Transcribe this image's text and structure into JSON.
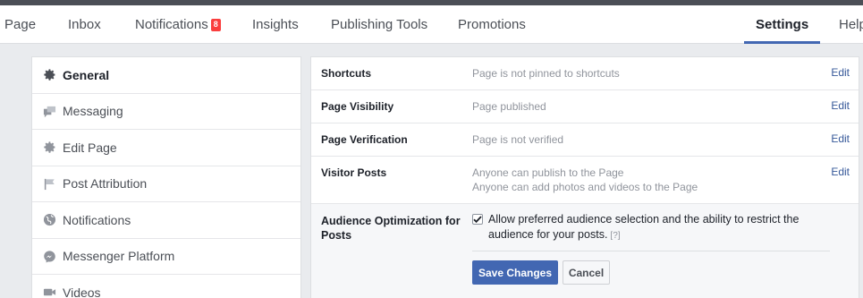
{
  "nav": {
    "items": [
      {
        "label": "Page"
      },
      {
        "label": "Inbox"
      },
      {
        "label": "Notifications",
        "badge": "8"
      },
      {
        "label": "Insights"
      },
      {
        "label": "Publishing Tools"
      },
      {
        "label": "Promotions"
      },
      {
        "label": "Settings",
        "active": true
      },
      {
        "label": "Help"
      }
    ]
  },
  "sidebar": {
    "items": [
      {
        "label": "General",
        "icon": "gear-icon",
        "active": true
      },
      {
        "label": "Messaging",
        "icon": "chat-bubbles-icon"
      },
      {
        "label": "Edit Page",
        "icon": "gear-icon"
      },
      {
        "label": "Post Attribution",
        "icon": "flag-icon"
      },
      {
        "label": "Notifications",
        "icon": "globe-icon"
      },
      {
        "label": "Messenger Platform",
        "icon": "messenger-icon"
      },
      {
        "label": "Videos",
        "icon": "video-camera-icon"
      }
    ]
  },
  "settings": {
    "rows": [
      {
        "label": "Shortcuts",
        "value": "Page is not pinned to shortcuts",
        "edit": "Edit"
      },
      {
        "label": "Page Visibility",
        "value": "Page published",
        "edit": "Edit"
      },
      {
        "label": "Page Verification",
        "value": "Page is not verified",
        "edit": "Edit"
      },
      {
        "label": "Visitor Posts",
        "value_line1": "Anyone can publish to the Page",
        "value_line2": "Anyone can add photos and videos to the Page",
        "edit": "Edit"
      }
    ],
    "expanded": {
      "label": "Audience Optimization for Posts",
      "checkbox_checked": true,
      "checkbox_text": "Allow preferred audience selection and the ability to restrict the audience for your posts.",
      "help": "[?]",
      "save_label": "Save Changes",
      "cancel_label": "Cancel"
    }
  },
  "colors": {
    "accent": "#4267b2",
    "link": "#365899",
    "badge": "#fa3e3e"
  }
}
